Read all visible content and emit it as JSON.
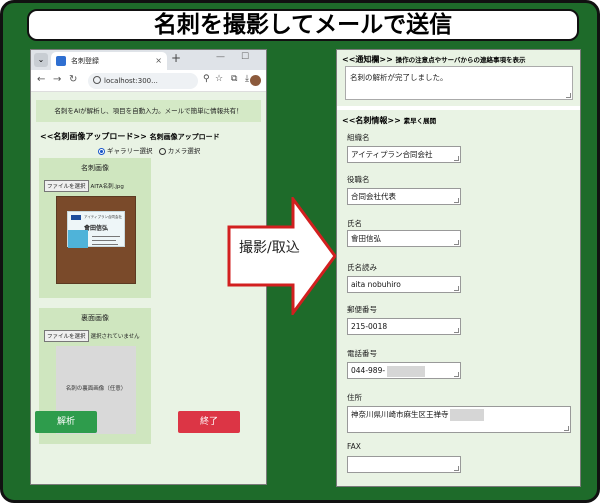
{
  "title": "名刺を撮影してメールで送信",
  "browser": {
    "tab_label": "名刺登録",
    "tab_close": "×",
    "new_tab": "+",
    "win_min": "—",
    "win_max": "☐",
    "url": "localhost:300..."
  },
  "app": {
    "banner": "名刺をAIが解析し、項目を自動入力。メールで簡単に情報共有！",
    "upload_title": "<<名刺画像アップロード>>",
    "upload_subtitle": "名刺画像アップロード",
    "radio_gallery": "ギャラリー選択",
    "radio_camera": "カメラ選択",
    "front_title": "名刺画像",
    "front_file_button": "ファイルを選択",
    "front_file_name": "AITA名刺.jpg",
    "back_title": "裏面画像",
    "back_file_button": "ファイルを選択",
    "back_file_name": "選択されていません",
    "back_placeholder": "名刺の裏面画像（任意）",
    "analyze_button": "解析",
    "exit_button": "終了"
  },
  "card_preview": {
    "company": "アイティプラン合同会社",
    "name": "會田信弘"
  },
  "arrow_label": "撮影/取込",
  "form": {
    "notice_title": "<<通知欄>>",
    "notice_subtitle": "操作の注意点やサーバからの連絡事項を表示",
    "notice_text": "名刺の解析が完了しました。",
    "info_title": "<<名刺情報>>",
    "info_subtitle": "素早く展開",
    "fields": [
      {
        "label": "組織名",
        "value": "アイティプラン合同会社"
      },
      {
        "label": "役職名",
        "value": "合同会社代表"
      },
      {
        "label": "氏名",
        "value": "會田信弘"
      },
      {
        "label": "氏名読み",
        "value": "aita nobuhiro"
      },
      {
        "label": "郵便番号",
        "value": "215-0018"
      },
      {
        "label": "電話番号",
        "value": "044-989-"
      },
      {
        "label": "住所",
        "value": "神奈川県川崎市麻生区王禅寺"
      },
      {
        "label": "FAX",
        "value": ""
      }
    ]
  }
}
